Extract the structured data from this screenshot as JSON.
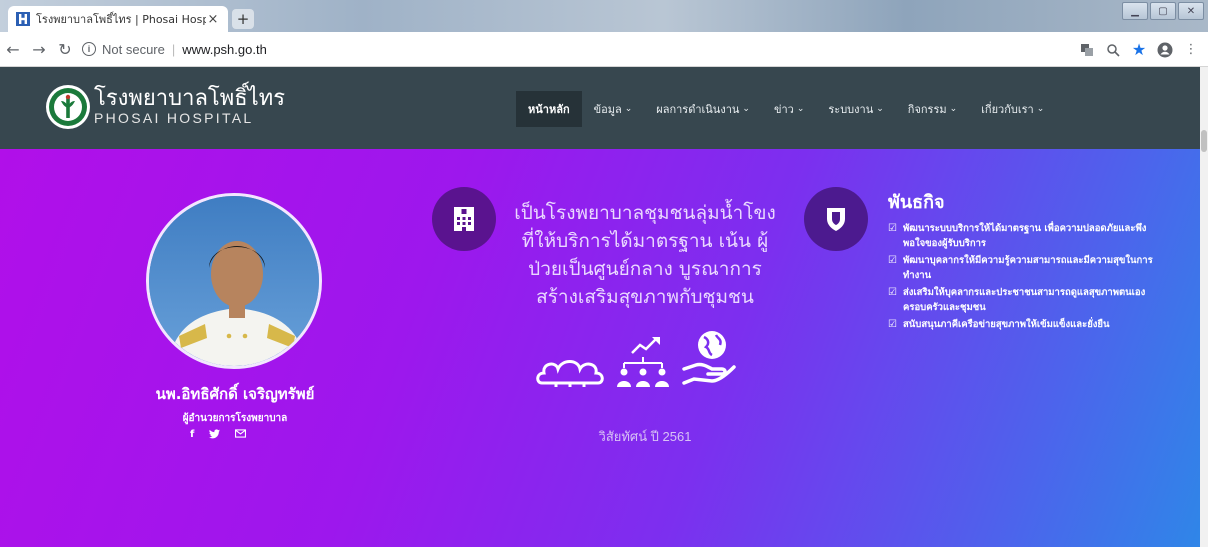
{
  "browser": {
    "tab_title": "โรงพยาบาลโพธิ์ไทร | Phosai Hospit",
    "close_glyph": "×",
    "new_tab_glyph": "+",
    "not_secure": "Not secure",
    "separator": "|",
    "url": "www.psh.go.th"
  },
  "header": {
    "logo_th": "โรงพยาบาลโพธิ์ไทร",
    "logo_en": "PHOSAI HOSPITAL",
    "nav": [
      {
        "label": "หน้าหลัก",
        "active": true
      },
      {
        "label": "ข้อมูล",
        "dropdown": true
      },
      {
        "label": "ผลการดำเนินงาน",
        "dropdown": true
      },
      {
        "label": "ข่าว",
        "dropdown": true
      },
      {
        "label": "ระบบงาน",
        "dropdown": true
      },
      {
        "label": "กิจกรรม",
        "dropdown": true
      },
      {
        "label": "เกี่ยวกับเรา",
        "dropdown": true
      }
    ]
  },
  "profile": {
    "name": "นพ.อิทธิศักดิ์ เจริญทรัพย์",
    "title": "ผู้อำนวยการโรงพยาบาล",
    "social": [
      "facebook-icon",
      "twitter-icon",
      "email-icon"
    ]
  },
  "vision": {
    "text": "เป็นโรงพยาบาลชุมชนลุ่มน้ำโขง ที่ให้บริการได้มาตรฐาน เน้น ผู้ป่วยเป็นศูนย์กลาง บูรณาการ สร้างเสริมสุขภาพกับชุมชน",
    "year": "วิสัยทัศน์ ปี 2561"
  },
  "mission": {
    "heading": "พันธกิจ",
    "items": [
      "พัฒนาระบบบริการให้ได้มาตรฐาน เพื่อความปลอดภัยและพึงพอใจของผู้รับบริการ",
      "พัฒนาบุคลากรให้มีความรู้ความสามารถและมีความสุขในการทำงาน",
      "ส่งเสริมให้บุคลากรและประชาชนสามารถดูแลสุขภาพตนเอง ครอบครัวและชุมชน",
      "สนับสนุนภาคีเครือข่ายสุขภาพให้เข้มแข็งและยั่งยืน"
    ]
  },
  "colors": {
    "header_bg": "#37474f",
    "hero_start": "#b10fe9",
    "hero_end": "#2f86e8"
  }
}
